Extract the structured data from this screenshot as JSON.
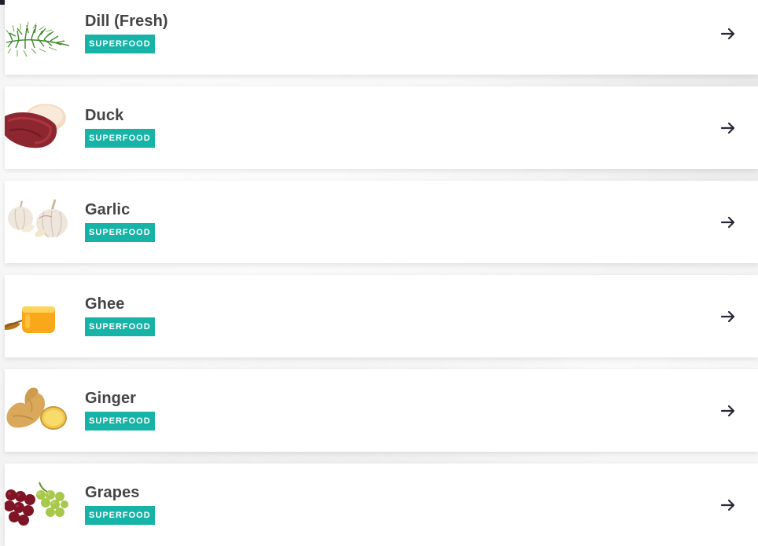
{
  "foods": [
    {
      "name": "Dill (Fresh)",
      "badge": "SUPERFOOD",
      "image": "dill-image"
    },
    {
      "name": "Duck",
      "badge": "SUPERFOOD",
      "image": "duck-image"
    },
    {
      "name": "Garlic",
      "badge": "SUPERFOOD",
      "image": "garlic-image"
    },
    {
      "name": "Ghee",
      "badge": "SUPERFOOD",
      "image": "ghee-image"
    },
    {
      "name": "Ginger",
      "badge": "SUPERFOOD",
      "image": "ginger-image"
    },
    {
      "name": "Grapes",
      "badge": "SUPERFOOD",
      "image": "grapes-image"
    }
  ],
  "colors": {
    "badge": "#17b3a6",
    "title": "#444444",
    "topbar": "#23202e"
  },
  "icons": {
    "arrow": "arrow-right-icon"
  }
}
